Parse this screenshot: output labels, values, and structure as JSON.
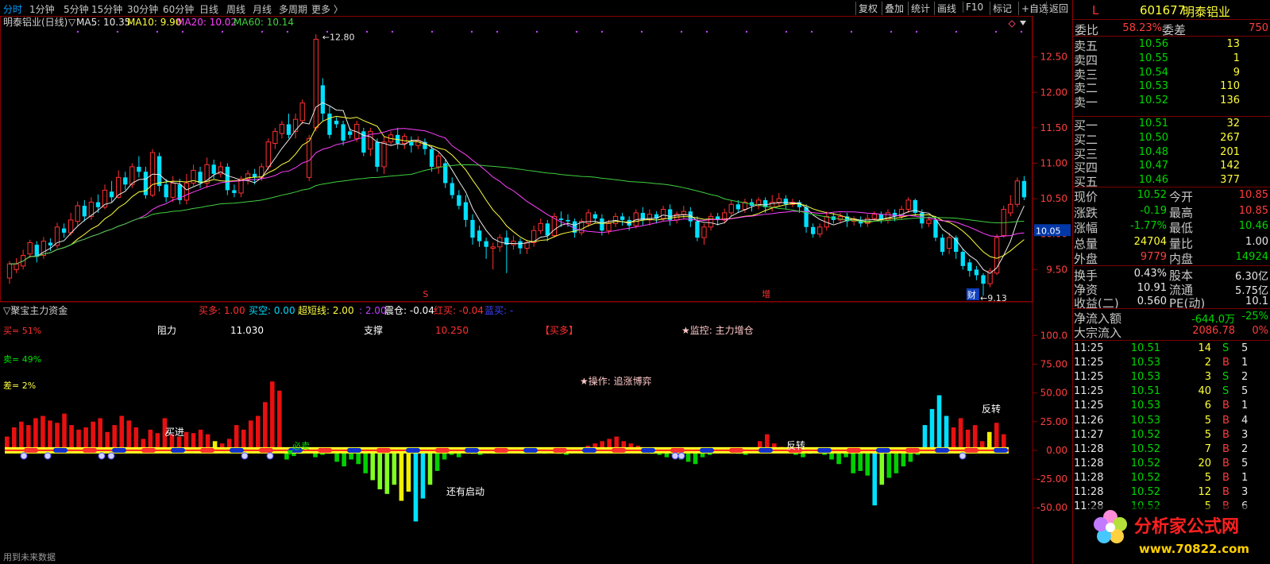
{
  "toolbar": {
    "timeframes": [
      "分时",
      "1分钟",
      "5分钟",
      "15分钟",
      "30分钟",
      "60分钟",
      "日线",
      "周线",
      "月线",
      "多周期",
      "更多 〉"
    ],
    "active_timeframe": "分时",
    "buttons": [
      "复权",
      "叠加",
      "统计",
      "画线",
      "F10",
      "标记",
      "+自选",
      "返回"
    ]
  },
  "main_chart": {
    "title": "明泰铝业(日线)",
    "indicator_prefix": "▽",
    "ma_labels": [
      {
        "text": "MA5: 10.35",
        "color": "#e8e8e8"
      },
      {
        "text": "MA10: 9.90",
        "color": "#ffff40"
      },
      {
        "text": "MA20: 10.02",
        "color": "#ff40ff"
      },
      {
        "text": "MA60: 10.14",
        "color": "#40d040"
      }
    ],
    "y_axis": [
      "12.50",
      "12.00",
      "11.50",
      "11.00",
      "10.50",
      "10.00",
      "9.50"
    ],
    "y_range": [
      9.1,
      12.9
    ],
    "current_price_tag": "10.05",
    "high_label": "12.80",
    "low_label": "9.13",
    "markers": [
      "S",
      "增",
      "财"
    ],
    "candles": [
      [
        9.38,
        9.58,
        9.3,
        9.62
      ],
      [
        9.5,
        9.58,
        9.45,
        9.66
      ],
      [
        9.55,
        9.7,
        9.5,
        9.78
      ],
      [
        9.72,
        9.88,
        9.66,
        9.92
      ],
      [
        9.85,
        9.68,
        9.6,
        9.9
      ],
      [
        9.7,
        9.9,
        9.65,
        9.96
      ],
      [
        9.88,
        9.84,
        9.76,
        9.94
      ],
      [
        9.84,
        10.1,
        9.8,
        10.16
      ],
      [
        10.08,
        10.02,
        9.95,
        10.15
      ],
      [
        10.02,
        10.2,
        9.98,
        10.3
      ],
      [
        10.18,
        10.4,
        10.12,
        10.46
      ],
      [
        10.4,
        10.25,
        10.18,
        10.48
      ],
      [
        10.25,
        10.45,
        10.2,
        10.52
      ],
      [
        10.45,
        10.38,
        10.3,
        10.56
      ],
      [
        10.38,
        10.62,
        10.35,
        10.7
      ],
      [
        10.6,
        10.52,
        10.45,
        10.75
      ],
      [
        10.52,
        10.8,
        10.5,
        10.9
      ],
      [
        10.8,
        10.7,
        10.62,
        10.88
      ],
      [
        10.7,
        10.95,
        10.65,
        11.0
      ],
      [
        10.95,
        10.88,
        10.8,
        11.1
      ],
      [
        10.88,
        10.55,
        10.5,
        10.95
      ],
      [
        10.55,
        11.15,
        10.52,
        11.2
      ],
      [
        11.1,
        10.68,
        10.6,
        11.15
      ],
      [
        10.7,
        10.52,
        10.45,
        10.78
      ],
      [
        10.52,
        10.72,
        10.45,
        10.82
      ],
      [
        10.7,
        10.48,
        10.42,
        10.78
      ],
      [
        10.48,
        10.72,
        10.42,
        10.85
      ],
      [
        10.72,
        10.9,
        10.68,
        10.98
      ],
      [
        10.88,
        10.72,
        10.65,
        10.95
      ],
      [
        10.72,
        10.98,
        10.65,
        11.08
      ],
      [
        10.98,
        10.85,
        10.78,
        11.05
      ],
      [
        10.85,
        10.95,
        10.8,
        11.02
      ],
      [
        10.95,
        10.62,
        10.55,
        11.0
      ],
      [
        10.62,
        10.58,
        10.52,
        10.7
      ],
      [
        10.58,
        10.78,
        10.52,
        10.82
      ],
      [
        10.78,
        10.85,
        10.7,
        10.9
      ],
      [
        10.85,
        10.8,
        10.7,
        10.92
      ],
      [
        10.8,
        10.95,
        10.75,
        11.0
      ],
      [
        10.95,
        11.3,
        10.9,
        11.35
      ],
      [
        11.28,
        11.45,
        11.2,
        11.5
      ],
      [
        11.42,
        11.55,
        11.35,
        11.6
      ],
      [
        11.55,
        11.4,
        11.35,
        11.7
      ],
      [
        11.45,
        11.62,
        11.35,
        11.7
      ],
      [
        11.6,
        11.85,
        11.55,
        11.9
      ],
      [
        10.8,
        11.35,
        10.75,
        11.4
      ],
      [
        11.5,
        12.75,
        11.45,
        12.82
      ],
      [
        12.1,
        11.7,
        11.6,
        12.2
      ],
      [
        11.7,
        11.4,
        11.35,
        11.8
      ],
      [
        11.6,
        11.55,
        11.5,
        11.65
      ],
      [
        11.55,
        11.32,
        11.25,
        11.6
      ],
      [
        11.45,
        11.4,
        11.35,
        11.5
      ],
      [
        11.35,
        11.55,
        11.3,
        11.6
      ],
      [
        11.45,
        11.15,
        11.1,
        11.5
      ],
      [
        11.2,
        11.45,
        11.1,
        11.5
      ],
      [
        11.3,
        10.95,
        10.88,
        11.35
      ],
      [
        10.95,
        11.3,
        10.85,
        11.38
      ],
      [
        11.3,
        11.4,
        11.25,
        11.45
      ],
      [
        11.4,
        11.28,
        11.2,
        11.5
      ],
      [
        11.28,
        11.38,
        11.2,
        11.42
      ],
      [
        11.3,
        11.25,
        11.15,
        11.38
      ],
      [
        11.25,
        11.32,
        11.2,
        11.38
      ],
      [
        11.3,
        11.2,
        11.12,
        11.35
      ],
      [
        11.2,
        10.95,
        10.88,
        11.25
      ],
      [
        10.95,
        11.1,
        10.85,
        11.15
      ],
      [
        11.0,
        10.72,
        10.65,
        11.05
      ],
      [
        10.72,
        10.55,
        10.5,
        10.8
      ],
      [
        10.55,
        10.4,
        10.35,
        10.62
      ],
      [
        10.45,
        10.2,
        10.1,
        10.55
      ],
      [
        10.2,
        9.95,
        9.85,
        10.28
      ],
      [
        10.05,
        9.9,
        9.82,
        10.12
      ],
      [
        9.9,
        9.82,
        9.65,
        9.95
      ],
      [
        9.8,
        9.82,
        9.5,
        9.88
      ],
      [
        9.82,
        9.95,
        9.75,
        10.0
      ],
      [
        9.95,
        9.85,
        9.45,
        10.05
      ],
      [
        9.85,
        9.9,
        9.78,
        9.98
      ],
      [
        9.9,
        9.8,
        9.72,
        9.94
      ],
      [
        9.8,
        9.88,
        9.72,
        9.92
      ],
      [
        9.88,
        10.05,
        9.82,
        10.12
      ],
      [
        10.05,
        10.15,
        10.0,
        10.22
      ],
      [
        10.15,
        9.98,
        9.9,
        10.2
      ],
      [
        9.98,
        10.25,
        9.95,
        10.3
      ],
      [
        10.22,
        10.2,
        10.1,
        10.32
      ],
      [
        10.2,
        10.18,
        10.1,
        10.28
      ],
      [
        10.18,
        10.02,
        9.95,
        10.22
      ],
      [
        10.02,
        10.18,
        9.98,
        10.22
      ],
      [
        10.15,
        10.3,
        10.1,
        10.35
      ],
      [
        10.28,
        10.22,
        10.15,
        10.32
      ],
      [
        10.22,
        10.05,
        9.98,
        10.28
      ],
      [
        10.05,
        10.15,
        10.0,
        10.2
      ],
      [
        10.15,
        10.25,
        10.1,
        10.3
      ],
      [
        10.25,
        10.2,
        10.12,
        10.3
      ],
      [
        10.2,
        10.12,
        10.05,
        10.25
      ],
      [
        10.12,
        10.3,
        10.08,
        10.35
      ],
      [
        10.3,
        10.2,
        10.12,
        10.38
      ],
      [
        10.2,
        10.28,
        10.12,
        10.35
      ],
      [
        10.28,
        10.22,
        10.15,
        10.32
      ],
      [
        10.22,
        10.35,
        10.18,
        10.4
      ],
      [
        10.35,
        10.2,
        10.12,
        10.42
      ],
      [
        10.2,
        10.28,
        10.15,
        10.32
      ],
      [
        10.28,
        10.32,
        10.22,
        10.4
      ],
      [
        10.32,
        10.18,
        10.1,
        10.38
      ],
      [
        10.18,
        9.95,
        9.9,
        10.25
      ],
      [
        9.95,
        10.1,
        9.85,
        10.15
      ],
      [
        10.1,
        10.25,
        10.05,
        10.3
      ],
      [
        10.25,
        10.2,
        10.12,
        10.3
      ],
      [
        10.2,
        10.3,
        10.15,
        10.36
      ],
      [
        10.3,
        10.42,
        10.25,
        10.48
      ],
      [
        10.42,
        10.35,
        10.3,
        10.48
      ],
      [
        10.35,
        10.45,
        10.3,
        10.5
      ],
      [
        10.45,
        10.4,
        10.32,
        10.5
      ],
      [
        10.4,
        10.48,
        10.35,
        10.52
      ],
      [
        10.48,
        10.38,
        10.3,
        10.52
      ],
      [
        10.38,
        10.45,
        10.32,
        10.55
      ],
      [
        10.45,
        10.5,
        10.4,
        10.58
      ],
      [
        10.5,
        10.42,
        10.35,
        10.55
      ],
      [
        10.42,
        10.45,
        10.38,
        10.5
      ],
      [
        10.45,
        10.38,
        10.3,
        10.48
      ],
      [
        10.38,
        10.1,
        10.02,
        10.42
      ],
      [
        10.1,
        10.0,
        9.95,
        10.15
      ],
      [
        10.0,
        10.1,
        9.95,
        10.15
      ],
      [
        10.1,
        10.25,
        10.05,
        10.32
      ],
      [
        10.25,
        10.2,
        10.15,
        10.3
      ],
      [
        10.2,
        10.25,
        10.15,
        10.3
      ],
      [
        10.25,
        10.18,
        10.1,
        10.3
      ],
      [
        10.18,
        10.2,
        10.12,
        10.25
      ],
      [
        10.2,
        10.15,
        10.1,
        10.25
      ],
      [
        10.15,
        10.22,
        10.1,
        10.28
      ],
      [
        10.22,
        10.28,
        10.18,
        10.32
      ],
      [
        10.28,
        10.2,
        10.15,
        10.32
      ],
      [
        10.2,
        10.3,
        10.15,
        10.35
      ],
      [
        10.3,
        10.25,
        10.18,
        10.35
      ],
      [
        10.25,
        10.35,
        10.2,
        10.4
      ],
      [
        10.35,
        10.48,
        10.3,
        10.52
      ],
      [
        10.48,
        10.3,
        10.25,
        10.5
      ],
      [
        10.3,
        10.15,
        10.08,
        10.35
      ],
      [
        10.15,
        10.2,
        10.1,
        10.25
      ],
      [
        10.2,
        9.95,
        9.9,
        10.25
      ],
      [
        9.95,
        9.75,
        9.7,
        10.0
      ],
      [
        9.8,
        9.95,
        9.72,
        10.02
      ],
      [
        9.95,
        9.75,
        9.65,
        9.98
      ],
      [
        9.75,
        9.55,
        9.5,
        9.8
      ],
      [
        9.6,
        9.48,
        9.4,
        9.65
      ],
      [
        9.5,
        9.42,
        9.35,
        9.55
      ],
      [
        9.42,
        9.3,
        9.13,
        9.45
      ],
      [
        9.3,
        9.48,
        9.25,
        9.52
      ],
      [
        9.45,
        9.95,
        9.42,
        10.0
      ],
      [
        9.98,
        10.35,
        9.95,
        10.4
      ],
      [
        10.3,
        10.42,
        10.25,
        10.55
      ],
      [
        10.42,
        10.75,
        10.38,
        10.8
      ],
      [
        10.75,
        10.52,
        10.48,
        10.82
      ]
    ]
  },
  "sub_chart": {
    "title": "聚宝主力资金",
    "title_prefix": "▽",
    "legend": [
      {
        "text": "买多: 1.00",
        "color": "#ff3030"
      },
      {
        "text": "买空: 0.00",
        "color": "#00d8ff"
      },
      {
        "text": "超短线: 2.00",
        "color": "#ffff40"
      },
      {
        "text": ": 2.00",
        "color": "#c040ff"
      },
      {
        "text": "震仓: -0.04",
        "color": "#ffffff"
      },
      {
        "text": "红买: -0.04",
        "color": "#ff3030"
      },
      {
        "text": "蓝买: -",
        "color": "#4040ff"
      }
    ],
    "buy_pct": "买= 51%",
    "sell_pct": "卖= 49%",
    "diff_pct": "差= 2%",
    "resistance_label": "阻力",
    "resistance_value": "11.030",
    "support_label": "支撑",
    "support_value": "10.250",
    "signal_tag": "【买多】",
    "monitor": "★监控: 主力增仓",
    "operation": "★操作: 追涨博弈",
    "y_axis": [
      "100.0",
      "75.00",
      "50.00",
      "25.00",
      "0.00",
      "-25.00",
      "-50.00"
    ],
    "y_range": [
      -70,
      110
    ],
    "annotations": [
      "买进",
      "必卖",
      "反转",
      "反转",
      "还有启动"
    ],
    "bars": [
      12,
      20,
      25,
      22,
      28,
      30,
      26,
      24,
      32,
      22,
      18,
      20,
      25,
      28,
      16,
      22,
      30,
      26,
      20,
      10,
      18,
      15,
      28,
      14,
      12,
      16,
      15,
      18,
      14,
      8,
      6,
      10,
      22,
      18,
      26,
      30,
      42,
      60,
      52,
      -8,
      -5,
      -3,
      -2,
      -6,
      -4,
      -3,
      -10,
      -14,
      -8,
      -12,
      -20,
      -26,
      -34,
      -38,
      -30,
      -44,
      -36,
      -62,
      -42,
      -30,
      -18,
      -8,
      -4,
      -6,
      -2,
      -3,
      -4,
      -2,
      -3,
      -2,
      -1,
      -2,
      -3,
      -2,
      -2,
      -3,
      -2,
      -3,
      -4,
      -2,
      -2,
      4,
      6,
      8,
      10,
      12,
      8,
      6,
      4,
      -2,
      -3,
      -4,
      -6,
      -5,
      -8,
      -10,
      -12,
      -6,
      -4,
      -2,
      -1,
      -2,
      -3,
      -4,
      -2,
      8,
      14,
      6,
      3,
      -2,
      -4,
      -6,
      -3,
      -2,
      -4,
      -8,
      -12,
      -6,
      -20,
      -18,
      -22,
      -48,
      -30,
      -24,
      -20,
      -14,
      -10,
      -4,
      22,
      36,
      48,
      30,
      20,
      28,
      18,
      22,
      8,
      16,
      24,
      14
    ],
    "bar_colors": {
      "pos": "#e81010",
      "yellow": "#f0f000",
      "green": "#00d000",
      "lime": "#80ff20",
      "cyan": "#00e0ff"
    },
    "footer": "用到未来数据"
  },
  "quote": {
    "code": "601677",
    "name": "明泰铝业",
    "flag": "L",
    "wb_label": "委比",
    "wb_value": "58.23%",
    "wc_label": "委差",
    "wc_value": "750",
    "asks": [
      {
        "label": "卖五",
        "price": "10.56",
        "vol": "13"
      },
      {
        "label": "卖四",
        "price": "10.55",
        "vol": "1"
      },
      {
        "label": "卖三",
        "price": "10.54",
        "vol": "9"
      },
      {
        "label": "卖二",
        "price": "10.53",
        "vol": "110"
      },
      {
        "label": "卖一",
        "price": "10.52",
        "vol": "136"
      }
    ],
    "bids": [
      {
        "label": "买一",
        "price": "10.51",
        "vol": "32"
      },
      {
        "label": "买二",
        "price": "10.50",
        "vol": "267"
      },
      {
        "label": "买三",
        "price": "10.48",
        "vol": "201"
      },
      {
        "label": "买四",
        "price": "10.47",
        "vol": "142"
      },
      {
        "label": "买五",
        "price": "10.46",
        "vol": "377"
      }
    ],
    "stats": [
      {
        "l1": "现价",
        "v1": "10.52",
        "c1": "g",
        "l2": "今开",
        "v2": "10.85",
        "c2": "r"
      },
      {
        "l1": "涨跌",
        "v1": "-0.19",
        "c1": "g",
        "l2": "最高",
        "v2": "10.85",
        "c2": "r"
      },
      {
        "l1": "涨幅",
        "v1": "-1.77%",
        "c1": "g",
        "l2": "最低",
        "v2": "10.46",
        "c2": "g"
      },
      {
        "l1": "总量",
        "v1": "24704",
        "c1": "y",
        "l2": "量比",
        "v2": "1.00",
        "c2": "w"
      },
      {
        "l1": "外盘",
        "v1": "9779",
        "c1": "r",
        "l2": "内盘",
        "v2": "14924",
        "c2": "g"
      }
    ],
    "fund": [
      {
        "l1": "换手",
        "v1": "0.43%",
        "l2": "股本",
        "v2": "6.30亿"
      },
      {
        "l1": "净资",
        "v1": "10.91",
        "l2": "流通",
        "v2": "5.75亿"
      },
      {
        "l1": "收益(二)",
        "v1": "0.560",
        "l2": "PE(动)",
        "v2": "10.1"
      }
    ],
    "flow": [
      {
        "label": "净流入额",
        "value": "-644.0万",
        "pct": "-25%",
        "color": "g"
      },
      {
        "label": "大宗流入",
        "value": "2086.78",
        "pct": "0%",
        "color": "r"
      }
    ],
    "ticks": [
      {
        "time": "11:25",
        "price": "10.51",
        "vol": "14",
        "side": "S",
        "n": "5"
      },
      {
        "time": "11:25",
        "price": "10.53",
        "vol": "2",
        "side": "B",
        "n": "1"
      },
      {
        "time": "11:25",
        "price": "10.53",
        "vol": "3",
        "side": "S",
        "n": "2"
      },
      {
        "time": "11:25",
        "price": "10.51",
        "vol": "40",
        "side": "S",
        "n": "5"
      },
      {
        "time": "11:25",
        "price": "10.53",
        "vol": "6",
        "side": "B",
        "n": "1"
      },
      {
        "time": "11:26",
        "price": "10.53",
        "vol": "5",
        "side": "B",
        "n": "4"
      },
      {
        "time": "11:27",
        "price": "10.52",
        "vol": "5",
        "side": "B",
        "n": "3"
      },
      {
        "time": "11:28",
        "price": "10.52",
        "vol": "7",
        "side": "B",
        "n": "2"
      },
      {
        "time": "11:28",
        "price": "10.52",
        "vol": "20",
        "side": "B",
        "n": "5"
      },
      {
        "time": "11:28",
        "price": "10.52",
        "vol": "5",
        "side": "B",
        "n": "1"
      },
      {
        "time": "11:28",
        "price": "10.52",
        "vol": "12",
        "side": "B",
        "n": "3"
      },
      {
        "time": "11:28",
        "price": "10.52",
        "vol": "5",
        "side": "B",
        "n": "6"
      }
    ],
    "watermark": "分析家公式网",
    "watermark_url": "www.70822.com"
  }
}
